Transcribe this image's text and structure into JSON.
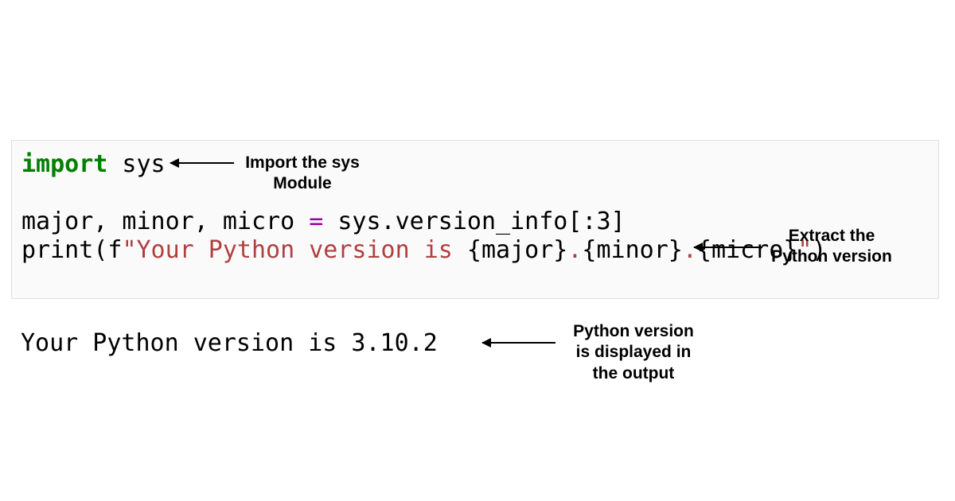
{
  "code": {
    "line1_keyword": "import",
    "line1_module": " sys",
    "line2_lhs": "major, minor, micro ",
    "line2_op": "=",
    "line2_rhs": " sys.version_info[:",
    "line2_num": "3",
    "line2_tail": "]",
    "line3_call": "print",
    "line3_open": "(f",
    "line3_str_literal": "\"Your Python version is ",
    "line3_brace1": "{major}",
    "line3_dot1": ".",
    "line3_brace2": "{minor}",
    "line3_dot2": ".",
    "line3_brace3": "{micro}",
    "line3_str_end": "\"",
    "line3_close": ")"
  },
  "output": "Your Python version is 3.10.2",
  "annotations": {
    "a1_line1": "Import the sys",
    "a1_line2": "Module",
    "a2_line1": "Extract the",
    "a2_line2": "Python version",
    "a3_line1": "Python version",
    "a3_line2": "is displayed in",
    "a3_line3": "the output"
  }
}
